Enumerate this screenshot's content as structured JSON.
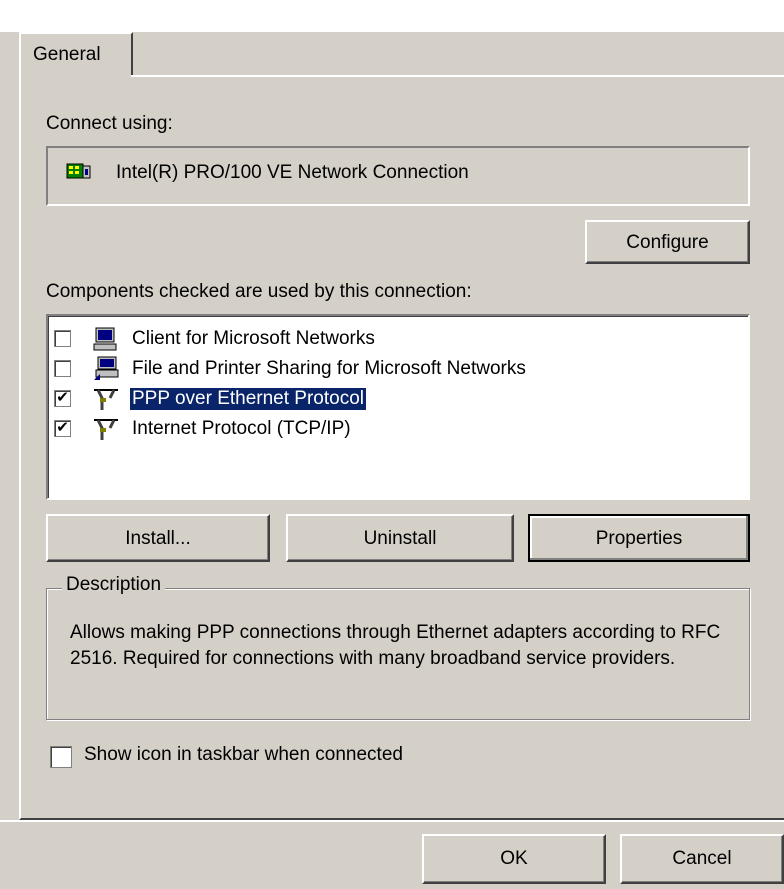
{
  "tab": {
    "label": "General"
  },
  "connect_using": {
    "label": "Connect using:",
    "adapter_icon": "network-adapter-icon",
    "adapter_name": "Intel(R) PRO/100 VE Network Connection",
    "configure_label": "Configure"
  },
  "components": {
    "label": "Components checked are used by this connection:",
    "items": [
      {
        "label": "Client for Microsoft Networks",
        "checked": false,
        "icon": "computer-icon",
        "selected": false
      },
      {
        "label": "File and Printer Sharing for Microsoft Networks",
        "checked": false,
        "icon": "printer-share-icon",
        "selected": false
      },
      {
        "label": "PPP over Ethernet Protocol",
        "checked": true,
        "icon": "protocol-icon",
        "selected": true
      },
      {
        "label": "Internet Protocol (TCP/IP)",
        "checked": true,
        "icon": "protocol-icon",
        "selected": false
      }
    ]
  },
  "buttons": {
    "install": "Install...",
    "uninstall": "Uninstall",
    "properties": "Properties",
    "ok": "OK",
    "cancel": "Cancel"
  },
  "description": {
    "legend": "Description",
    "text": "Allows making PPP connections through Ethernet adapters according to RFC 2516. Required for connections with many broadband service providers."
  },
  "taskbar": {
    "label": "Show icon in taskbar when connected",
    "checked": false
  },
  "colors": {
    "face": "#d4d0c8",
    "selection": "#0a246a"
  }
}
